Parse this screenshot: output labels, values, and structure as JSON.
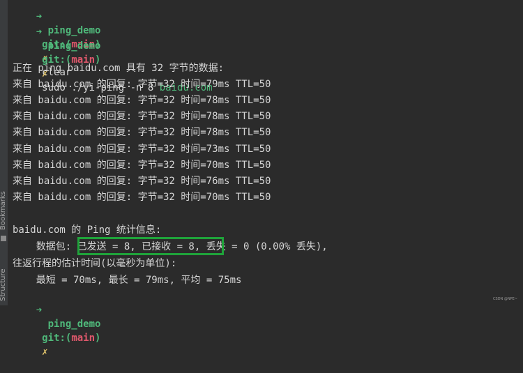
{
  "sidebar": {
    "bookmarks_label": "Bookmarks",
    "structure_label": "Structure"
  },
  "prompts": [
    {
      "arrow": "➜",
      "dir": "ping_demo",
      "git": "git:(",
      "branch": "main",
      "git_close": ")",
      "dirty": "✗",
      "command": "clear",
      "url": ""
    },
    {
      "arrow": "➜",
      "dir": "ping_demo",
      "git": "git:(",
      "branch": "main",
      "git_close": ")",
      "dirty": "✗",
      "command": "sudo ./yi-ping -n 8 ",
      "url": "baidu.com"
    },
    {
      "arrow": "➜",
      "dir": "ping_demo",
      "git": "git:(",
      "branch": "main",
      "git_close": ")",
      "dirty": "✗",
      "command": "",
      "url": ""
    }
  ],
  "output": {
    "header": "正在 ping baidu.com 具有 32 字节的数据:",
    "replies": [
      "来自 baidu.com 的回复: 字节=32 时间=79ms TTL=50",
      "来自 baidu.com 的回复: 字节=32 时间=78ms TTL=50",
      "来自 baidu.com 的回复: 字节=32 时间=78ms TTL=50",
      "来自 baidu.com 的回复: 字节=32 时间=78ms TTL=50",
      "来自 baidu.com 的回复: 字节=32 时间=73ms TTL=50",
      "来自 baidu.com 的回复: 字节=32 时间=70ms TTL=50",
      "来自 baidu.com 的回复: 字节=32 时间=76ms TTL=50",
      "来自 baidu.com 的回复: 字节=32 时间=70ms TTL=50"
    ],
    "stats_title": "baidu.com 的 Ping 统计信息:",
    "packets_line": "    数据包: 已发送 = 8, 已接收 = 8, 丢失 = 0 (0.00% 丢失),",
    "rtt_title": "往返行程的估计时间(以毫秒为单位):",
    "rtt_line": "    最短 = 70ms, 最长 = 79ms, 平均 = 75ms"
  },
  "watermark": "CSDN @NPE~",
  "colors": {
    "background": "#2b2b2b",
    "prompt_green": "#4fb87a",
    "branch_red": "#e0586c",
    "dirty_yellow": "#e0c46c",
    "highlight_box": "#1fa33a"
  }
}
